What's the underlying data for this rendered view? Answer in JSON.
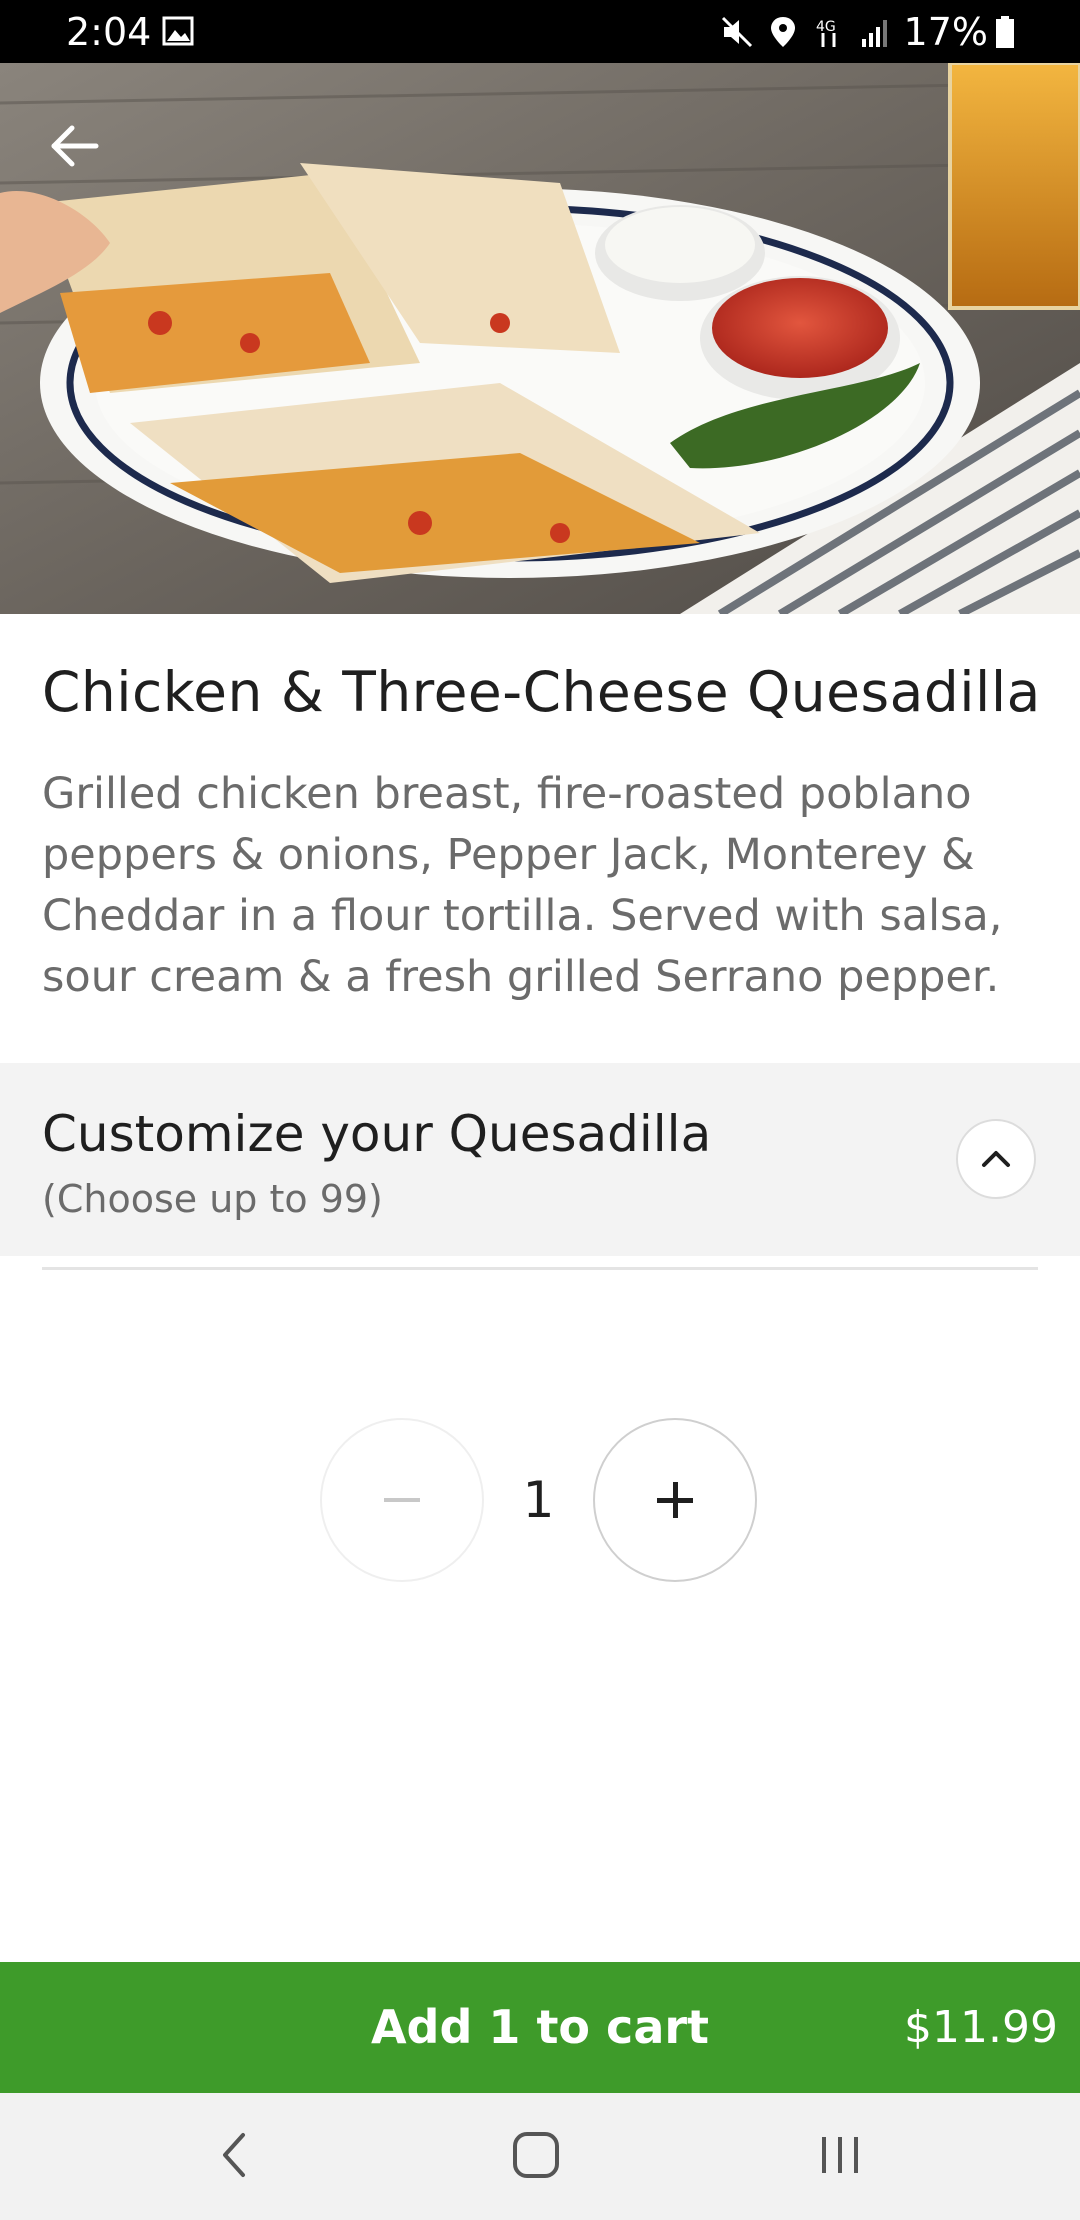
{
  "status_bar": {
    "time": "2:04",
    "battery_text": "17%",
    "icons": [
      "image-icon",
      "mute-icon",
      "location-icon",
      "data-transfer-icon",
      "signal-icon",
      "battery-icon"
    ]
  },
  "item": {
    "title": "Chicken & Three-Cheese Quesadilla",
    "description": "Grilled chicken breast, fire-roasted poblano peppers & onions, Pepper Jack, Monterey & Cheddar in a flour tortilla. Served with salsa, sour cream & a fresh grilled Serrano pepper."
  },
  "customize": {
    "title": "Customize your Quesadilla",
    "subtitle": "(Choose up to 99)"
  },
  "quantity": {
    "value": "1"
  },
  "cart": {
    "label": "Add 1 to cart",
    "price": "$11.99"
  },
  "colors": {
    "accent_green": "#3e9b2a",
    "section_bg": "#f3f3f3"
  }
}
